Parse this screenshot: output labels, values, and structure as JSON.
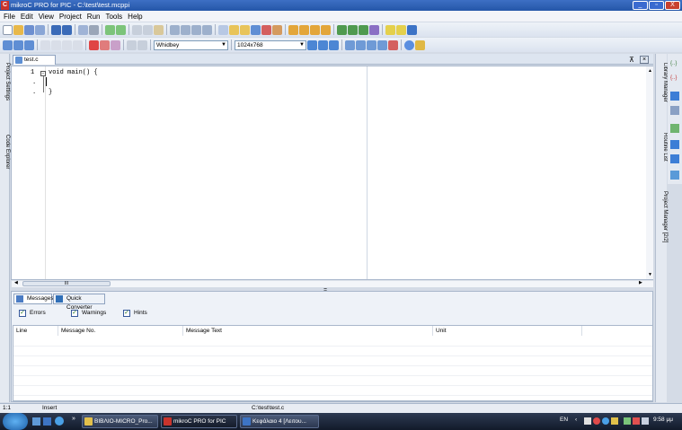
{
  "window": {
    "title": "mikroC PRO for PIC - C:\\test\\test.mcppi",
    "app_icon": "C",
    "minimize": "_",
    "maximize": "▫",
    "close": "X"
  },
  "menu": [
    "File",
    "Edit",
    "View",
    "Project",
    "Run",
    "Tools",
    "Help"
  ],
  "toolbar2": {
    "scheme": "Whidbey",
    "resolution": "1024x768"
  },
  "left_panels": [
    "Project Settings",
    "Code Explorer"
  ],
  "right_panels": [
    "Library Manager",
    "Routine List",
    "Project Manager [2/2]"
  ],
  "editor": {
    "tab": "test.c",
    "lines": [
      {
        "num": "1",
        "text": "void main() {"
      },
      {
        "num": ".",
        "text": ""
      },
      {
        "num": ".",
        "text": "}"
      }
    ],
    "hscroll_label": "III",
    "split_grip": "::::::::"
  },
  "messages": {
    "tabs": [
      "Messages",
      "Quick Converter"
    ],
    "filters": [
      {
        "label": "Errors",
        "checked": true
      },
      {
        "label": "Warnings",
        "checked": true
      },
      {
        "label": "Hints",
        "checked": true
      }
    ],
    "columns": [
      "Line",
      "Message No.",
      "Message Text",
      "Unit"
    ]
  },
  "status": {
    "position": "1:1",
    "mode": "Insert",
    "file": "C:\\test\\test.c"
  },
  "taskbar": {
    "tasks": [
      "BIBΛΙΟ-MICRO_Pro...",
      "mikroC PRO for PIC",
      "Κεφάλαιο 4 [Λειτου..."
    ],
    "lang": "EN",
    "time": "9:58 μμ",
    "chevron": "»"
  },
  "colors": {
    "title": "#2456a8",
    "menu": "#f2f4f8",
    "taskbar": "#121a2a"
  }
}
